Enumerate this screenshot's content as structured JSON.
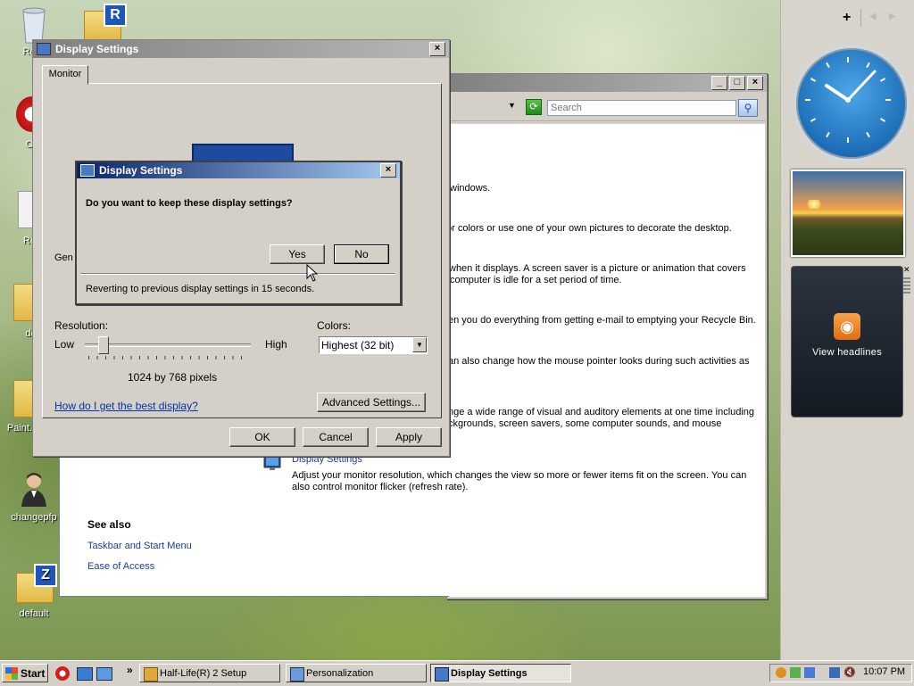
{
  "desktop": {
    "icons": [
      {
        "label": "Recy"
      },
      {
        "label": "Op"
      },
      {
        "label": "Rea"
      },
      {
        "label": "def"
      },
      {
        "label": "Paint.N Por"
      },
      {
        "label": "changepfp"
      },
      {
        "label": "default"
      }
    ],
    "folder_badge_r": "R",
    "folder_badge_z": "Z"
  },
  "sidebar": {
    "add_label": "+",
    "feed_label": "View headlines"
  },
  "personalization": {
    "search_placeholder": "Search",
    "text_line1": "windows.",
    "text_line2": "or colors or use one of your own pictures to decorate the desktop.",
    "text_line3a": "when it displays. A screen saver is a picture or animation that covers",
    "text_line3b": "computer is idle for a set period of time.",
    "text_line4": "en you do everything from getting e-mail to emptying your Recycle Bin.",
    "text_line5": "an also change how the mouse pointer looks during such activities as",
    "text_line6a": "nge a wide range of visual and auditory elements at one time including",
    "text_line6b": "ckgrounds, screen savers, some computer sounds, and mouse",
    "display_link": "Display Settings",
    "display_desc1": "Adjust your monitor resolution, which changes the view so more or fewer items fit on the screen. You can",
    "display_desc2": "also control monitor flicker (refresh rate).",
    "see_also": "See also",
    "see_also_1": "Taskbar and Start Menu",
    "see_also_2": "Ease of Access"
  },
  "display_settings": {
    "title": "Display Settings",
    "tab": "Monitor",
    "gen_label": "Gen",
    "resolution_label": "Resolution:",
    "low": "Low",
    "high": "High",
    "resolution_value": "1024 by 768 pixels",
    "slider_level": 0.08,
    "colors_label": "Colors:",
    "colors_value": "Highest (32 bit)",
    "help_link": "How do I get the best display?",
    "advanced_btn": "Advanced Settings...",
    "ok_btn": "OK",
    "cancel_btn": "Cancel",
    "apply_btn": "Apply"
  },
  "confirm": {
    "title": "Display Settings",
    "question": "Do you want to keep these display settings?",
    "yes_btn": "Yes",
    "no_btn": "No",
    "revert_text": "Reverting to previous display settings in 15 seconds."
  },
  "taskbar": {
    "start": "Start",
    "quick_arrow": "»",
    "items": [
      "Half-Life(R) 2 Setup",
      "Personalization",
      "Display Settings"
    ],
    "clock": "10:07 PM"
  }
}
